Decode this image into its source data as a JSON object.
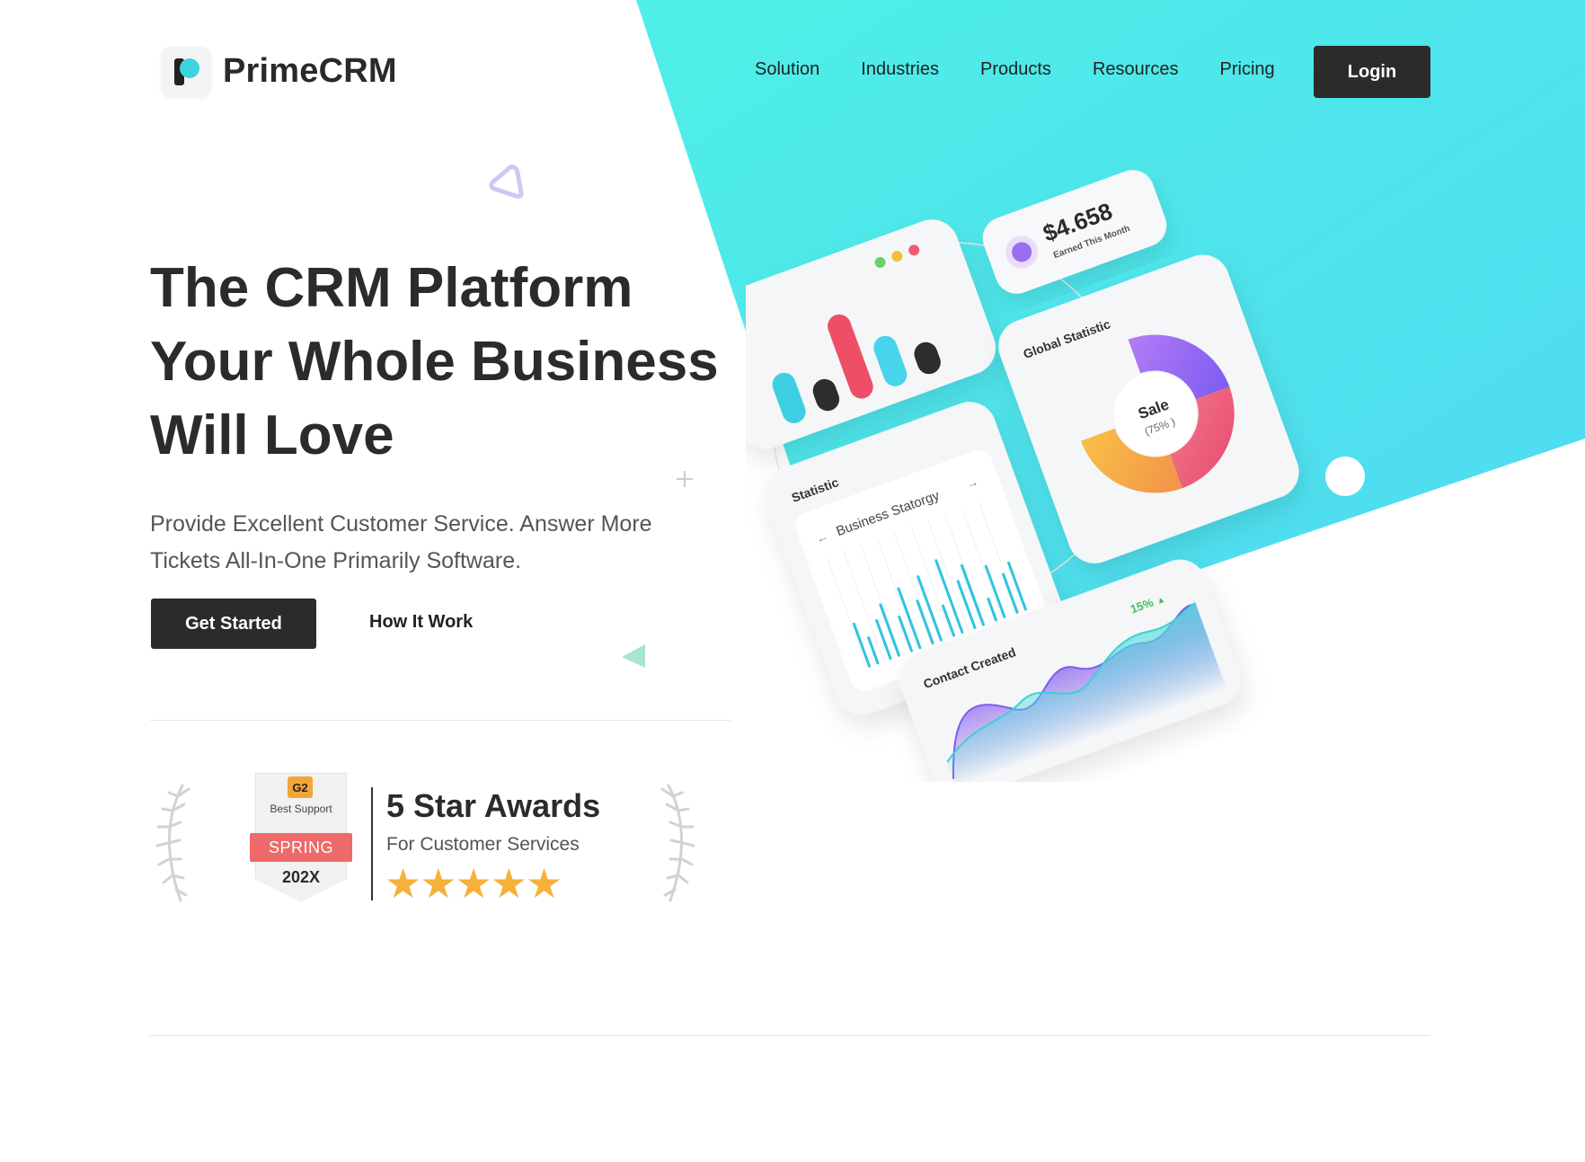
{
  "brand": {
    "name": "PrimeCRM"
  },
  "nav": {
    "items": [
      "Solution",
      "Industries",
      "Products",
      "Resources",
      "Pricing"
    ],
    "login_label": "Login"
  },
  "hero": {
    "headline_lines": [
      "The CRM Platform",
      "Your Whole Business",
      "Will Love"
    ],
    "subtext": "Provide Excellent Customer Service. Answer More Tickets All-In-One Primarily Software.",
    "primary_cta": "Get Started",
    "secondary_cta": "How It Work"
  },
  "award": {
    "badge_brand": "G2",
    "badge_label": "Best Support",
    "badge_season": "SPRING",
    "badge_year": "202X",
    "title": "5 Star Awards",
    "subtitle": "For Customer Services",
    "stars": 5,
    "star_color": "#f6b13a"
  },
  "dashboard": {
    "earned_amount": "$4.658",
    "earned_label": "Earned This Month",
    "statistic_label": "Statistic",
    "business_title": "Business Statorgy",
    "global_label": "Global Statistic",
    "sale_label": "Sale",
    "sale_percent": "(75% )",
    "contact_label": "Contact Created",
    "contact_change": "15%"
  },
  "colors": {
    "accent_cyan": "#46e6ec",
    "dark": "#2b2b2b",
    "badge_red": "#ee6a6a",
    "badge_gold": "#f2a63a"
  }
}
